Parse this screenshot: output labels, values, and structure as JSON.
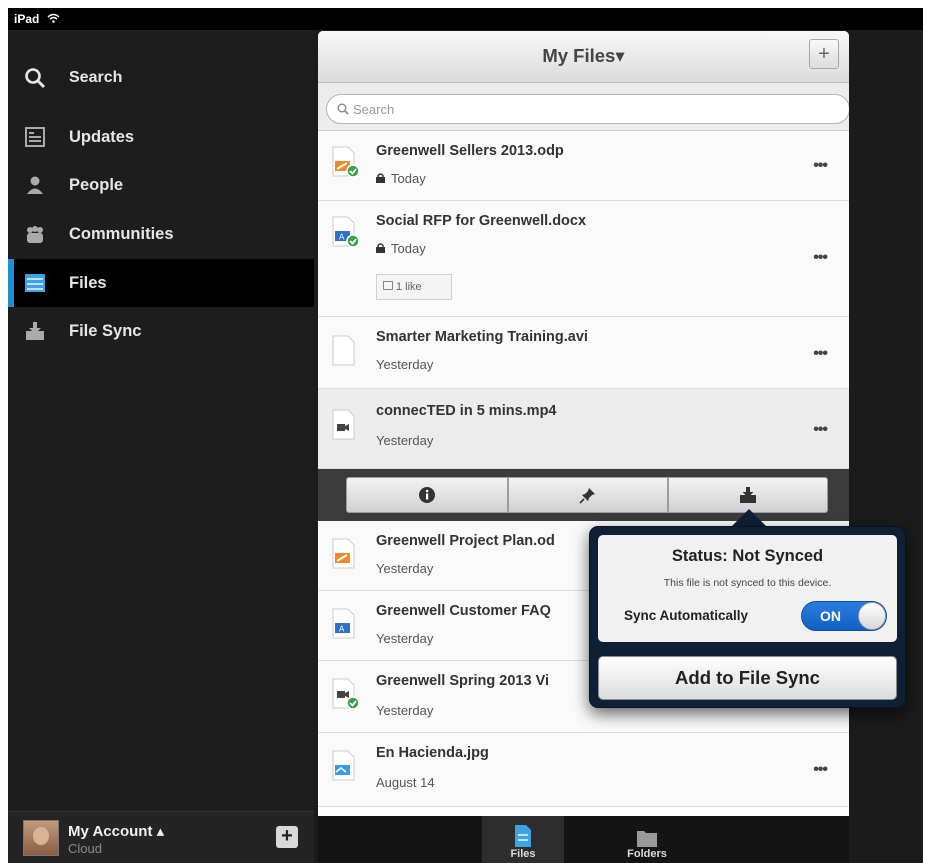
{
  "statusbar": {
    "device": "iPad"
  },
  "sidebar": {
    "search_label": "Search",
    "items": [
      {
        "label": "Updates",
        "icon": "updates-icon"
      },
      {
        "label": "People",
        "icon": "person-icon"
      },
      {
        "label": "Communities",
        "icon": "communities-icon"
      },
      {
        "label": "Files",
        "icon": "files-icon",
        "active": true
      },
      {
        "label": "File Sync",
        "icon": "file-sync-icon"
      }
    ],
    "account": {
      "name": "My Account ▴",
      "subtitle": "Cloud"
    }
  },
  "main": {
    "title": "My Files▾",
    "search_placeholder": "Search",
    "files": [
      {
        "name": "Greenwell Sellers 2013.odp",
        "date": "Today",
        "locked": true,
        "synced": true,
        "icon": "presentation-file-icon"
      },
      {
        "name": "Social RFP for Greenwell.docx",
        "date": "Today",
        "locked": true,
        "synced": true,
        "likes": "1 like",
        "icon": "document-file-icon"
      },
      {
        "name": "Smarter Marketing Training.avi",
        "date": "Yesterday",
        "icon": "blank-file-icon"
      },
      {
        "name": "connecTED in 5 mins.mp4",
        "date": "Yesterday",
        "icon": "video-file-icon",
        "selected": true
      },
      {
        "name": "Greenwell Project Plan.od",
        "date": "Yesterday",
        "icon": "presentation-file-icon"
      },
      {
        "name": "Greenwell Customer FAQ",
        "date": "Yesterday",
        "icon": "document-file-icon"
      },
      {
        "name": "Greenwell Spring 2013 Vi",
        "date": "Yesterday",
        "synced": true,
        "icon": "video-file-icon"
      },
      {
        "name": "En Hacienda.jpg",
        "date": "August 14",
        "icon": "image-file-icon"
      }
    ],
    "more_label": "•••"
  },
  "tabbar": {
    "tabs": [
      {
        "label": "Files",
        "active": true
      },
      {
        "label": "Folders"
      }
    ]
  },
  "popover": {
    "title": "Status: Not Synced",
    "description": "This file is not synced to this device.",
    "sync_label": "Sync Automatically",
    "toggle_label": "ON",
    "toggle_state": true,
    "add_button": "Add to File Sync"
  },
  "colors": {
    "accent": "#1f8fd6",
    "toggle_on": "#1a6fd3",
    "popover_bg": "#0f2035"
  }
}
